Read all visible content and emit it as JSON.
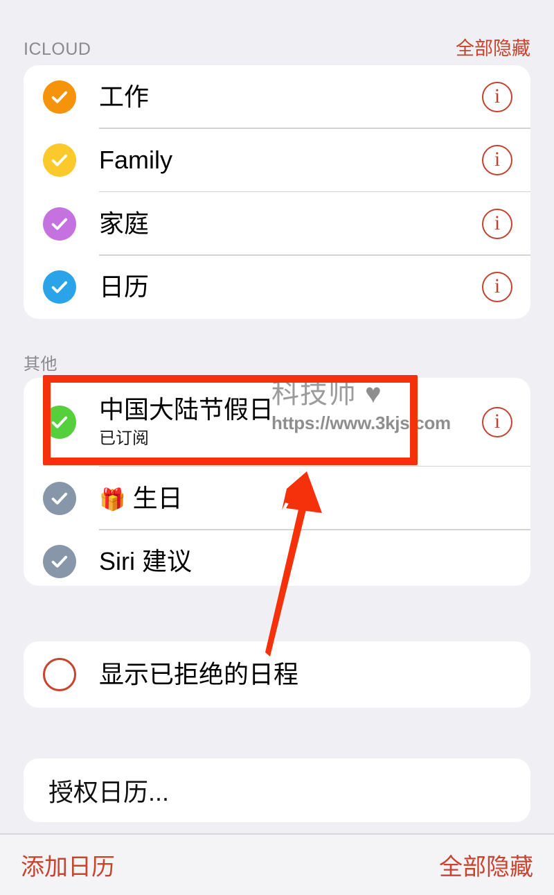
{
  "screen": {
    "title": "日历",
    "background_color": "#EFEFF4",
    "accent_red": "#C7452F",
    "annotation_red": "#F4310A"
  },
  "sections": [
    {
      "id": "icloud",
      "header_title": "ICLOUD",
      "header_action": "全部隐藏",
      "rows": [
        {
          "label": "工作",
          "checked": true,
          "color": "#F5930A",
          "info": "i"
        },
        {
          "label": "Family",
          "checked": true,
          "color": "#FBC92B",
          "info": "i"
        },
        {
          "label": "家庭",
          "checked": true,
          "color": "#C571E0",
          "info": "i"
        },
        {
          "label": "日历",
          "checked": true,
          "color": "#2BA3E8",
          "info": "i"
        }
      ]
    },
    {
      "id": "other",
      "header_title": "其他",
      "rows": [
        {
          "label": "中国大陆节假日",
          "sublabel": "已订阅",
          "checked": true,
          "color": "#56CF3C",
          "info": "i",
          "highlighted": true
        },
        {
          "label": "生日",
          "checked": true,
          "color": "#8796A8",
          "icon": "gift-icon",
          "icon_glyph": "🎁"
        },
        {
          "label": "Siri 建议",
          "checked": true,
          "color": "#8796A8"
        }
      ]
    }
  ],
  "declined": {
    "label": "显示已拒绝的日程",
    "checked": false,
    "outline_color": "#C7452F"
  },
  "authorize": {
    "label": "授权日历..."
  },
  "toolbar": {
    "add_label": "添加日历",
    "hide_all_label": "全部隐藏"
  },
  "watermark": {
    "brand": "科技师",
    "heart": "♥",
    "url": "https://www.3kjs.com",
    "color": "#9B9B9B"
  },
  "annotations": {
    "highlight_target": "中国大陆节假日",
    "arrow": {
      "color": "#F4310A",
      "points_to": "中国大陆节假日"
    }
  }
}
